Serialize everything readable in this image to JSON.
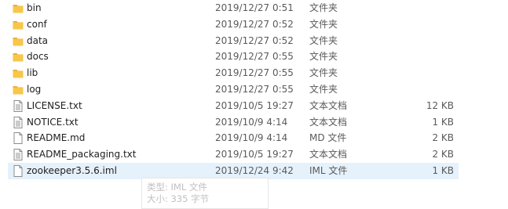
{
  "files": [
    {
      "name": "bin",
      "date": "2019/12/27 0:51",
      "type": "文件夹",
      "size": "",
      "icon": "folder-icon"
    },
    {
      "name": "conf",
      "date": "2019/12/27 0:52",
      "type": "文件夹",
      "size": "",
      "icon": "folder-icon"
    },
    {
      "name": "data",
      "date": "2019/12/27 0:52",
      "type": "文件夹",
      "size": "",
      "icon": "folder-icon"
    },
    {
      "name": "docs",
      "date": "2019/12/27 0:55",
      "type": "文件夹",
      "size": "",
      "icon": "folder-icon"
    },
    {
      "name": "lib",
      "date": "2019/12/27 0:55",
      "type": "文件夹",
      "size": "",
      "icon": "folder-icon"
    },
    {
      "name": "log",
      "date": "2019/12/27 0:55",
      "type": "文件夹",
      "size": "",
      "icon": "folder-icon"
    },
    {
      "name": "LICENSE.txt",
      "date": "2019/10/5 19:27",
      "type": "文本文档",
      "size": "12 KB",
      "icon": "text-document-icon"
    },
    {
      "name": "NOTICE.txt",
      "date": "2019/10/9 4:14",
      "type": "文本文档",
      "size": "1 KB",
      "icon": "text-document-icon"
    },
    {
      "name": "README.md",
      "date": "2019/10/9 4:14",
      "type": "MD 文件",
      "size": "2 KB",
      "icon": "file-icon"
    },
    {
      "name": "README_packaging.txt",
      "date": "2019/10/5 19:27",
      "type": "文本文档",
      "size": "2 KB",
      "icon": "text-document-icon"
    },
    {
      "name": "zookeeper3.5.6.iml",
      "date": "2019/12/24 9:42",
      "type": "IML 文件",
      "size": "1 KB",
      "icon": "file-icon",
      "selected": true
    }
  ],
  "tooltip": {
    "line1": "类型: IML 文件",
    "line2": "大小: 335 字节"
  },
  "colors": {
    "folder": "#f8c648",
    "selection": "#e5f1fb"
  }
}
